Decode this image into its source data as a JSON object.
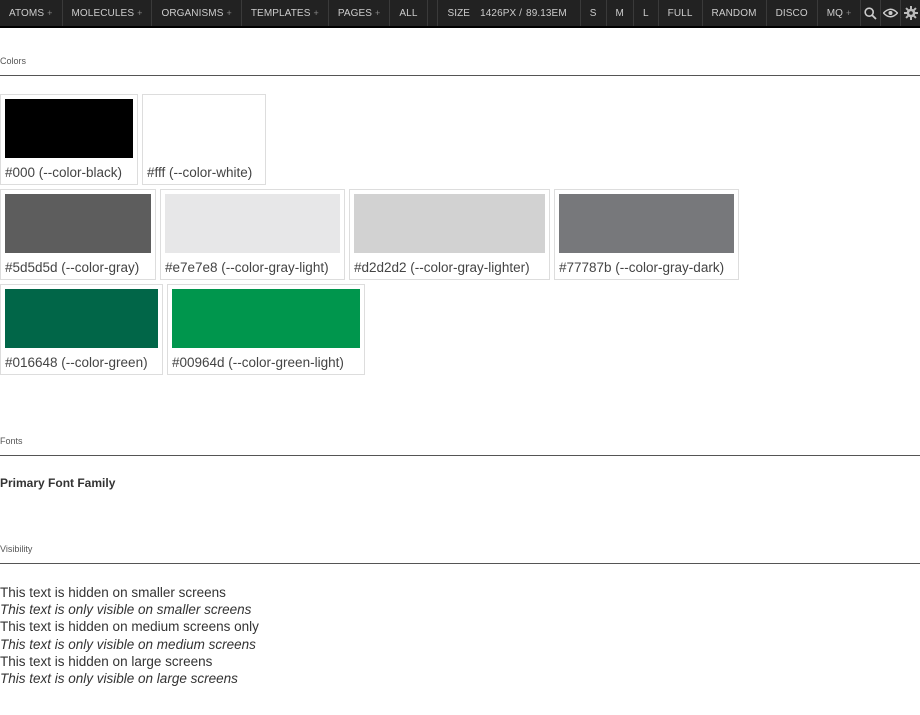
{
  "toolbar": {
    "nav": [
      {
        "label": "ATOMS",
        "plus": "+"
      },
      {
        "label": "MOLECULES",
        "plus": "+"
      },
      {
        "label": "ORGANISMS",
        "plus": "+"
      },
      {
        "label": "TEMPLATES",
        "plus": "+"
      },
      {
        "label": "PAGES",
        "plus": "+"
      },
      {
        "label": "ALL",
        "plus": ""
      }
    ],
    "size_label": "SIZE",
    "size_px": "1426PX /",
    "size_em": "89.13EM",
    "modes": [
      "S",
      "M",
      "L",
      "FULL",
      "RANDOM",
      "DISCO"
    ],
    "mq": {
      "label": "MQ",
      "plus": "+"
    }
  },
  "colors": {
    "section_label": "Colors",
    "rows": [
      [
        {
          "hex": "#000000",
          "label": "#000 (--color-black)"
        },
        {
          "hex": "#ffffff",
          "label": "#fff (--color-white)"
        }
      ],
      [
        {
          "hex": "#5d5d5d",
          "label": "#5d5d5d (--color-gray)"
        },
        {
          "hex": "#e7e7e8",
          "label": "#e7e7e8 (--color-gray-light)"
        },
        {
          "hex": "#d2d2d2",
          "label": "#d2d2d2 (--color-gray-lighter)"
        },
        {
          "hex": "#77787b",
          "label": "#77787b (--color-gray-dark)"
        }
      ],
      [
        {
          "hex": "#016648",
          "label": "#016648 (--color-green)"
        },
        {
          "hex": "#00964d",
          "label": "#00964d (--color-green-light)"
        }
      ]
    ]
  },
  "fonts": {
    "section_label": "Fonts",
    "primary": "Primary Font Family"
  },
  "visibility": {
    "section_label": "Visibility",
    "lines": [
      {
        "text": "This text is hidden on smaller screens",
        "italic": false
      },
      {
        "text": "This text is only visible on smaller screens",
        "italic": true
      },
      {
        "text": "This text is hidden on medium screens only",
        "italic": false
      },
      {
        "text": "This text is only visible on medium screens",
        "italic": true
      },
      {
        "text": "This text is hidden on large screens",
        "italic": false
      },
      {
        "text": "This text is only visible on large screens",
        "italic": true
      }
    ]
  }
}
